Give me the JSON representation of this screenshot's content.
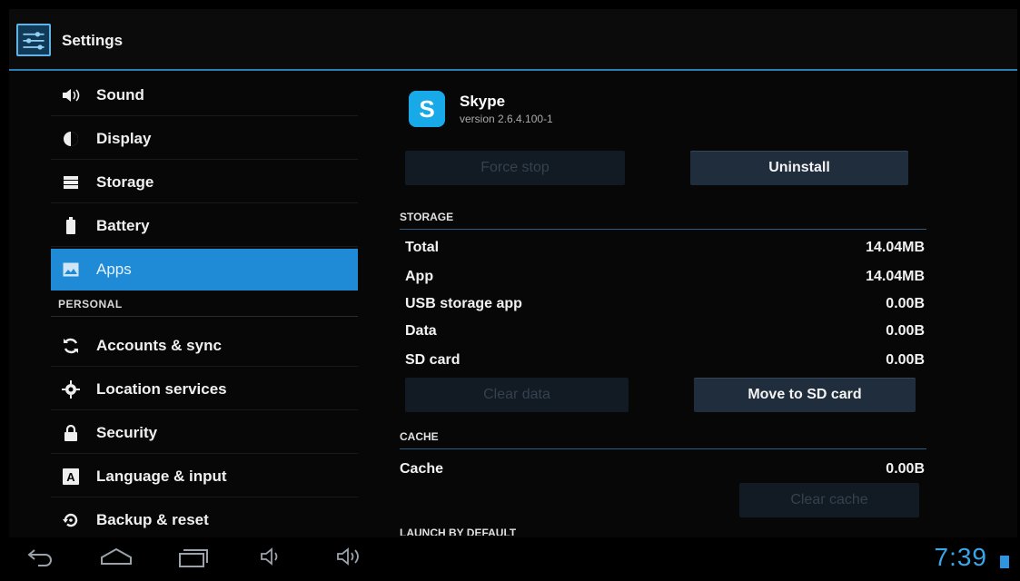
{
  "actionbar": {
    "title": "Settings",
    "icon": "settings-sliders-icon"
  },
  "nav": {
    "items": [
      {
        "label": "Sound",
        "icon": "speaker-icon"
      },
      {
        "label": "Display",
        "icon": "display-icon"
      },
      {
        "label": "Storage",
        "icon": "storage-icon"
      },
      {
        "label": "Battery",
        "icon": "battery-icon"
      },
      {
        "label": "Apps",
        "icon": "apps-icon",
        "selected": true
      }
    ],
    "personal_header": "PERSONAL",
    "personal_items": [
      {
        "label": "Accounts & sync",
        "icon": "sync-icon"
      },
      {
        "label": "Location services",
        "icon": "location-icon"
      },
      {
        "label": "Security",
        "icon": "lock-icon"
      },
      {
        "label": "Language & input",
        "icon": "language-icon"
      },
      {
        "label": "Backup & reset",
        "icon": "backup-icon"
      }
    ]
  },
  "app": {
    "name": "Skype",
    "version": "version 2.6.4.100-1",
    "icon_letter": "S"
  },
  "buttons": {
    "force_stop": "Force stop",
    "uninstall": "Uninstall",
    "clear_data": "Clear data",
    "move_to_sd": "Move to SD card",
    "clear_cache": "Clear cache"
  },
  "storage": {
    "title": "STORAGE",
    "rows": [
      {
        "label": "Total",
        "value": "14.04MB"
      },
      {
        "label": "App",
        "value": "14.04MB"
      },
      {
        "label": "USB storage app",
        "value": "0.00B"
      },
      {
        "label": "Data",
        "value": "0.00B"
      },
      {
        "label": "SD card",
        "value": "0.00B"
      }
    ]
  },
  "cache": {
    "title": "CACHE",
    "rows": [
      {
        "label": "Cache",
        "value": "0.00B"
      }
    ]
  },
  "launch_title": "LAUNCH BY DEFAULT",
  "statusbar": {
    "time": "7:39"
  },
  "colors": {
    "accent": "#1f8ad6",
    "clock": "#3aa6ea",
    "skype": "#17a9e8"
  }
}
